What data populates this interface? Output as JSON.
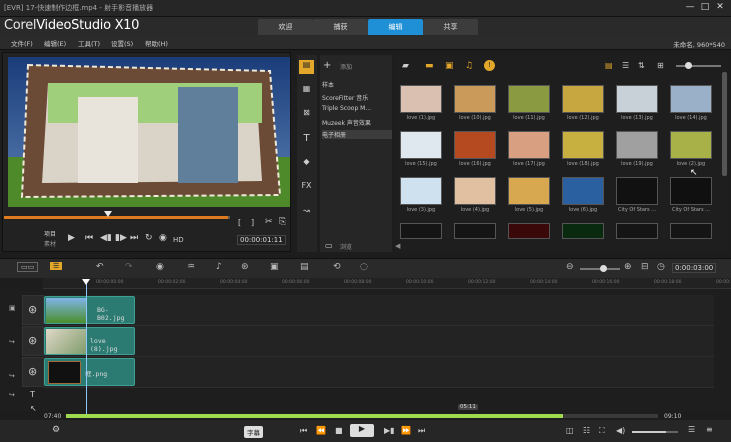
{
  "window": {
    "title": "[EVR] 17-快速制作边框.mp4 - 射手影音播放器",
    "controls": [
      "—",
      "□",
      "✕"
    ]
  },
  "app": {
    "logo_left": "Corel",
    "logo_right": "VideoStudio X10"
  },
  "steps": [
    "欢迎",
    "捕获",
    "编辑",
    "共享"
  ],
  "active_step": 2,
  "menu": [
    "文件(F)",
    "编辑(E)",
    "工具(T)",
    "设置(S)",
    "帮助(H)"
  ],
  "project_info": "未命名, 960*540",
  "player": {
    "mode_project": "项目",
    "mode_clip": "素材",
    "quality": "HD",
    "timecode": "00:00:01:11",
    "progress_fraction": 0.99
  },
  "library": {
    "add_label": "添加",
    "browse_label": "浏览",
    "categories": [
      "样本",
      "ScoreFitter 音乐",
      "Triple Scoop M...",
      "Muzeek 声音效果",
      "电子相册"
    ],
    "selected_category": 4,
    "thumbs": [
      {
        "label": "love (1).jpg",
        "color": "#d9c0b0"
      },
      {
        "label": "love (10).jpg",
        "color": "#c99a5a"
      },
      {
        "label": "love (11).jpg",
        "color": "#8a9a40"
      },
      {
        "label": "love (12).jpg",
        "color": "#c7a840"
      },
      {
        "label": "love (13).jpg",
        "color": "#c8d0d8"
      },
      {
        "label": "love (14).jpg",
        "color": "#9ab0c8"
      },
      {
        "label": "love (15).jpg",
        "color": "#dfe7ef"
      },
      {
        "label": "love (16).jpg",
        "color": "#b54a20"
      },
      {
        "label": "love (17).jpg",
        "color": "#d8a080"
      },
      {
        "label": "love (18).jpg",
        "color": "#c8b040"
      },
      {
        "label": "love (19).jpg",
        "color": "#a0a0a0"
      },
      {
        "label": "love (2).jpg",
        "color": "#a8b048"
      },
      {
        "label": "love (3).jpg",
        "color": "#cfe0ef"
      },
      {
        "label": "love (4).jpg",
        "color": "#e0c0a0"
      },
      {
        "label": "love (5).jpg",
        "color": "#d8a850"
      },
      {
        "label": "love (6).jpg",
        "color": "#2a60a0"
      },
      {
        "label": "City Of Stars ...",
        "color": "#111111"
      },
      {
        "label": "City Of Stars ...",
        "color": "#101010"
      }
    ]
  },
  "timeline": {
    "ruler": [
      "00:00:00:00",
      "00:00:02:00",
      "00:00:04:00",
      "00:00:06:00",
      "00:00:08:00",
      "00:00:10:00",
      "00:00:12:00",
      "00:00:14:00",
      "00:00:16:00",
      "00:00:18:00",
      "00:00:20:00"
    ],
    "timecode": "0:00:03:00",
    "clips": [
      "BG-B02.jpg",
      "love (8).jpg",
      "框.png"
    ],
    "scroll_left": "07:40",
    "scroll_right": "09:10",
    "scroll_badge": "05:11",
    "scroll_fraction": 0.84
  },
  "bottom": {
    "subtitle_btn": "字幕"
  }
}
